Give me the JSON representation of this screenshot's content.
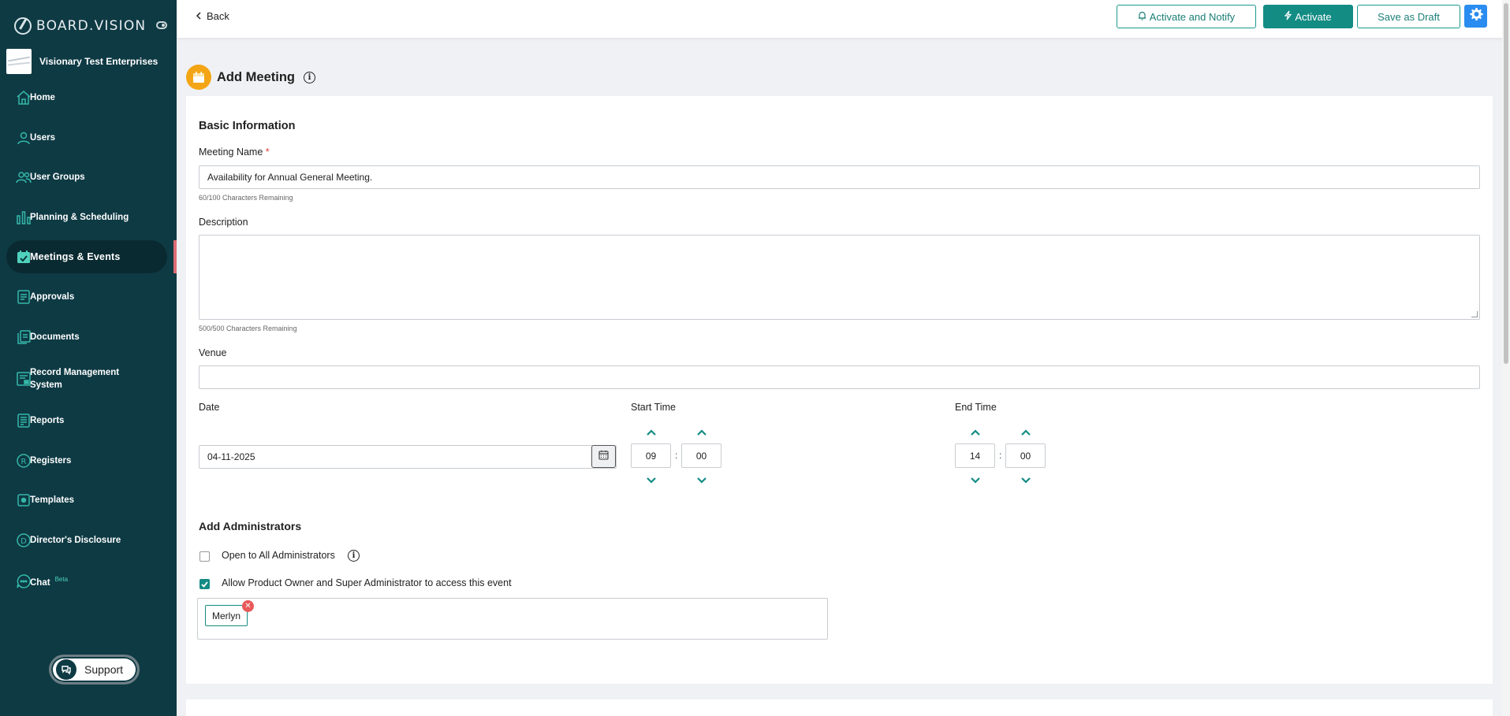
{
  "brand": {
    "name": "BOARD.VISION"
  },
  "org": {
    "name": "Visionary Test Enterprises"
  },
  "sidebar": {
    "items": [
      {
        "label": "Home"
      },
      {
        "label": "Users"
      },
      {
        "label": "User Groups"
      },
      {
        "label": "Planning & Scheduling"
      },
      {
        "label": "Meetings & Events"
      },
      {
        "label": "Approvals"
      },
      {
        "label": "Documents"
      },
      {
        "label": "Record Management System"
      },
      {
        "label": "Reports"
      },
      {
        "label": "Registers"
      },
      {
        "label": "Templates"
      },
      {
        "label": "Director's Disclosure"
      },
      {
        "label": "Chat",
        "badge": "Beta"
      }
    ],
    "support_label": "Support"
  },
  "topbar": {
    "back_label": "Back",
    "activate_notify_label": "Activate and Notify",
    "activate_label": "Activate",
    "save_draft_label": "Save as Draft"
  },
  "page": {
    "title": "Add Meeting"
  },
  "basic": {
    "section_title": "Basic Information",
    "meeting_name_label": "Meeting Name",
    "meeting_name_required": "*",
    "meeting_name_value": "Availability for Annual General Meeting.",
    "meeting_name_hint": "60/100 Characters Remaining",
    "description_label": "Description",
    "description_value": "",
    "description_hint": "500/500 Characters Remaining",
    "venue_label": "Venue",
    "venue_value": "",
    "date_label": "Date",
    "date_value": "04-11-2025",
    "start_time_label": "Start Time",
    "start_hour": "09",
    "start_minute": "00",
    "end_time_label": "End Time",
    "end_hour": "14",
    "end_minute": "00",
    "time_separator": ":"
  },
  "admins": {
    "section_title": "Add Administrators",
    "open_all_label": "Open to All Administrators",
    "open_all_checked": false,
    "allow_owner_label": "Allow Product Owner and Super Administrator to access this event",
    "allow_owner_checked": true,
    "selected": [
      "Merlyn"
    ]
  },
  "colors": {
    "sidebar_bg": "#0e3a44",
    "accent": "#138c84",
    "nav_icon": "#35b8a8",
    "active_marker": "#e06c75",
    "gear_button": "#2a8cf0",
    "page_icon": "#f3a515",
    "remove_chip": "#e85a5a"
  }
}
